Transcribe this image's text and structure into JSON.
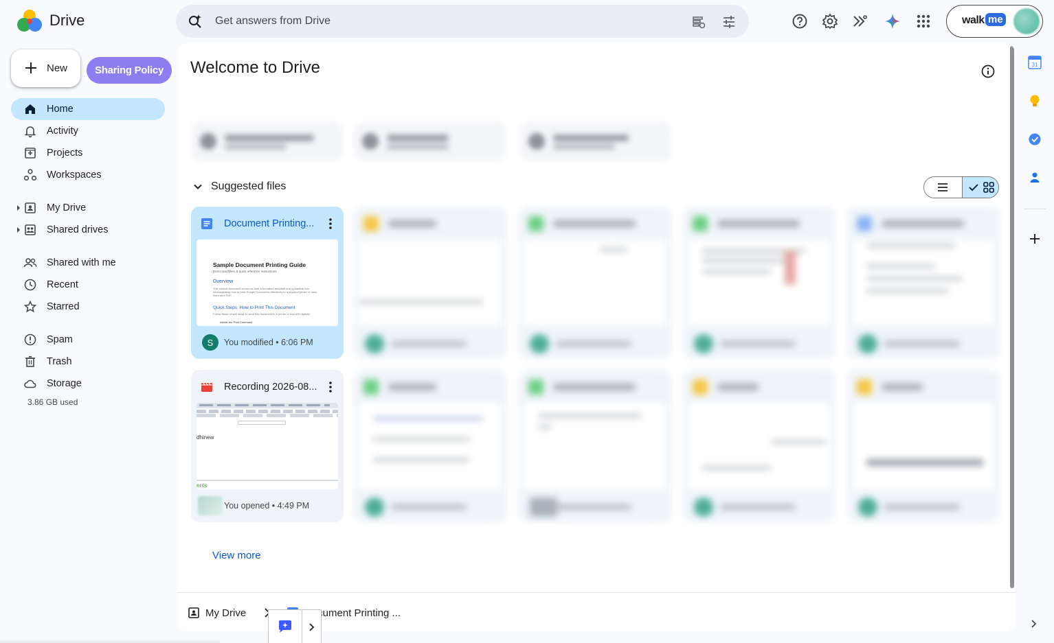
{
  "app": {
    "name": "Drive"
  },
  "search": {
    "placeholder": "Get answers from Drive"
  },
  "header": {
    "walkme_left": "walk",
    "walkme_right": "me"
  },
  "sidebar": {
    "new_label": "New",
    "sharing_policy_label": "Sharing Policy",
    "items": [
      {
        "label": "Home",
        "icon": "home-icon",
        "active": true
      },
      {
        "label": "Activity",
        "icon": "bell-icon"
      },
      {
        "label": "Projects",
        "icon": "projects-icon"
      },
      {
        "label": "Workspaces",
        "icon": "workspaces-icon"
      },
      {
        "label": "My Drive",
        "icon": "my-drive-icon"
      },
      {
        "label": "Shared drives",
        "icon": "shared-drives-icon"
      },
      {
        "label": "Shared with me",
        "icon": "people-icon"
      },
      {
        "label": "Recent",
        "icon": "clock-icon"
      },
      {
        "label": "Starred",
        "icon": "star-icon"
      },
      {
        "label": "Spam",
        "icon": "spam-icon"
      },
      {
        "label": "Trash",
        "icon": "trash-icon"
      },
      {
        "label": "Storage",
        "icon": "cloud-icon"
      }
    ],
    "storage_used": "3.86 GB used"
  },
  "main": {
    "title": "Welcome to Drive",
    "suggested_title": "Suggested files",
    "view_more": "View more",
    "cards": [
      {
        "title": "Document Printing...",
        "meta": "You modified • 6:06 PM",
        "avatar": "S",
        "thumb": {
          "heading": "Sample Document Printing Guide",
          "sub": "Demo text/fillers & quick reference instructions",
          "section1": "Overview",
          "para": "This sample document serves as both a formatted template and a practical tool demonstrating how to print Google Documents effectively to a physical printer or save them as a PDF.",
          "section2": "Quick Steps: How to Print This Document",
          "para2": "Follow these simple steps to send this document to a printer or export it digitally.",
          "step": "Initiate the Print Command"
        }
      },
      {
        "title": "Recording 2026-08...",
        "meta": "You opened • 4:49 PM",
        "thumb": {
          "text1": "dhinew",
          "text2": "ents"
        }
      }
    ]
  },
  "breadcrumb": {
    "root": "My Drive",
    "current": "Document Printing ..."
  },
  "colors": {
    "accent": "#0b57d0",
    "active_nav": "#c2e7ff",
    "sharing_policy": "#8a7ef0"
  }
}
